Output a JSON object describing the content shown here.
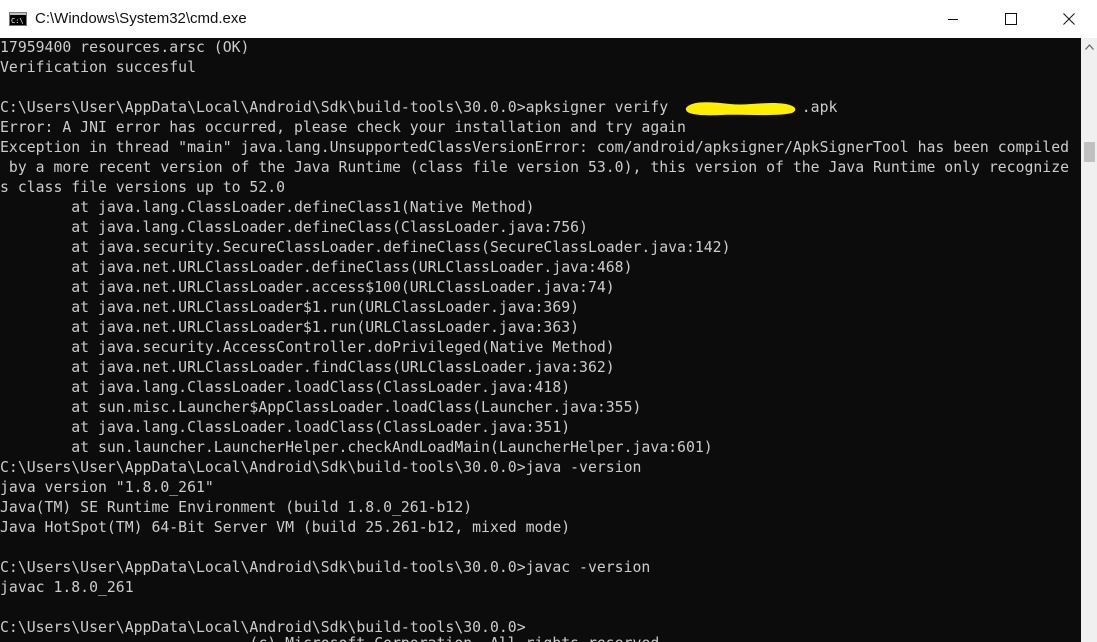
{
  "window": {
    "title": "C:\\Windows\\System32\\cmd.exe"
  },
  "icons": {
    "app": "cmd-icon",
    "minimize": "minimize-icon",
    "maximize": "maximize-icon",
    "close": "close-icon",
    "scroll_up": "scroll-up-arrow-icon"
  },
  "colors": {
    "console_bg": "#0c0c0c",
    "console_text": "#cccccc",
    "redaction": "#ffee00"
  },
  "console": {
    "lines": [
      "17959400 resources.arsc (OK)",
      "Verification succesful",
      "",
      "C:\\Users\\User\\AppData\\Local\\Android\\Sdk\\build-tools\\30.0.0>apksigner verify               .apk",
      "Error: A JNI error has occurred, please check your installation and try again",
      "Exception in thread \"main\" java.lang.UnsupportedClassVersionError: com/android/apksigner/ApkSignerTool has been compiled",
      " by a more recent version of the Java Runtime (class file version 53.0), this version of the Java Runtime only recognize",
      "s class file versions up to 52.0",
      "        at java.lang.ClassLoader.defineClass1(Native Method)",
      "        at java.lang.ClassLoader.defineClass(ClassLoader.java:756)",
      "        at java.security.SecureClassLoader.defineClass(SecureClassLoader.java:142)",
      "        at java.net.URLClassLoader.defineClass(URLClassLoader.java:468)",
      "        at java.net.URLClassLoader.access$100(URLClassLoader.java:74)",
      "        at java.net.URLClassLoader$1.run(URLClassLoader.java:369)",
      "        at java.net.URLClassLoader$1.run(URLClassLoader.java:363)",
      "        at java.security.AccessController.doPrivileged(Native Method)",
      "        at java.net.URLClassLoader.findClass(URLClassLoader.java:362)",
      "        at java.lang.ClassLoader.loadClass(ClassLoader.java:418)",
      "        at sun.misc.Launcher$AppClassLoader.loadClass(Launcher.java:355)",
      "        at java.lang.ClassLoader.loadClass(ClassLoader.java:351)",
      "        at sun.launcher.LauncherHelper.checkAndLoadMain(LauncherHelper.java:601)",
      "C:\\Users\\User\\AppData\\Local\\Android\\Sdk\\build-tools\\30.0.0>java -version",
      "java version \"1.8.0_261\"",
      "Java(TM) SE Runtime Environment (build 1.8.0_261-b12)",
      "Java HotSpot(TM) 64-Bit Server VM (build 25.261-b12, mixed mode)",
      "",
      "C:\\Users\\User\\AppData\\Local\\Android\\Sdk\\build-tools\\30.0.0>javac -version",
      "javac 1.8.0_261",
      "",
      "C:\\Users\\User\\AppData\\Local\\Android\\Sdk\\build-tools\\30.0.0>",
      "                            (c) Microsoft Corporation. All rights reserved."
    ]
  }
}
